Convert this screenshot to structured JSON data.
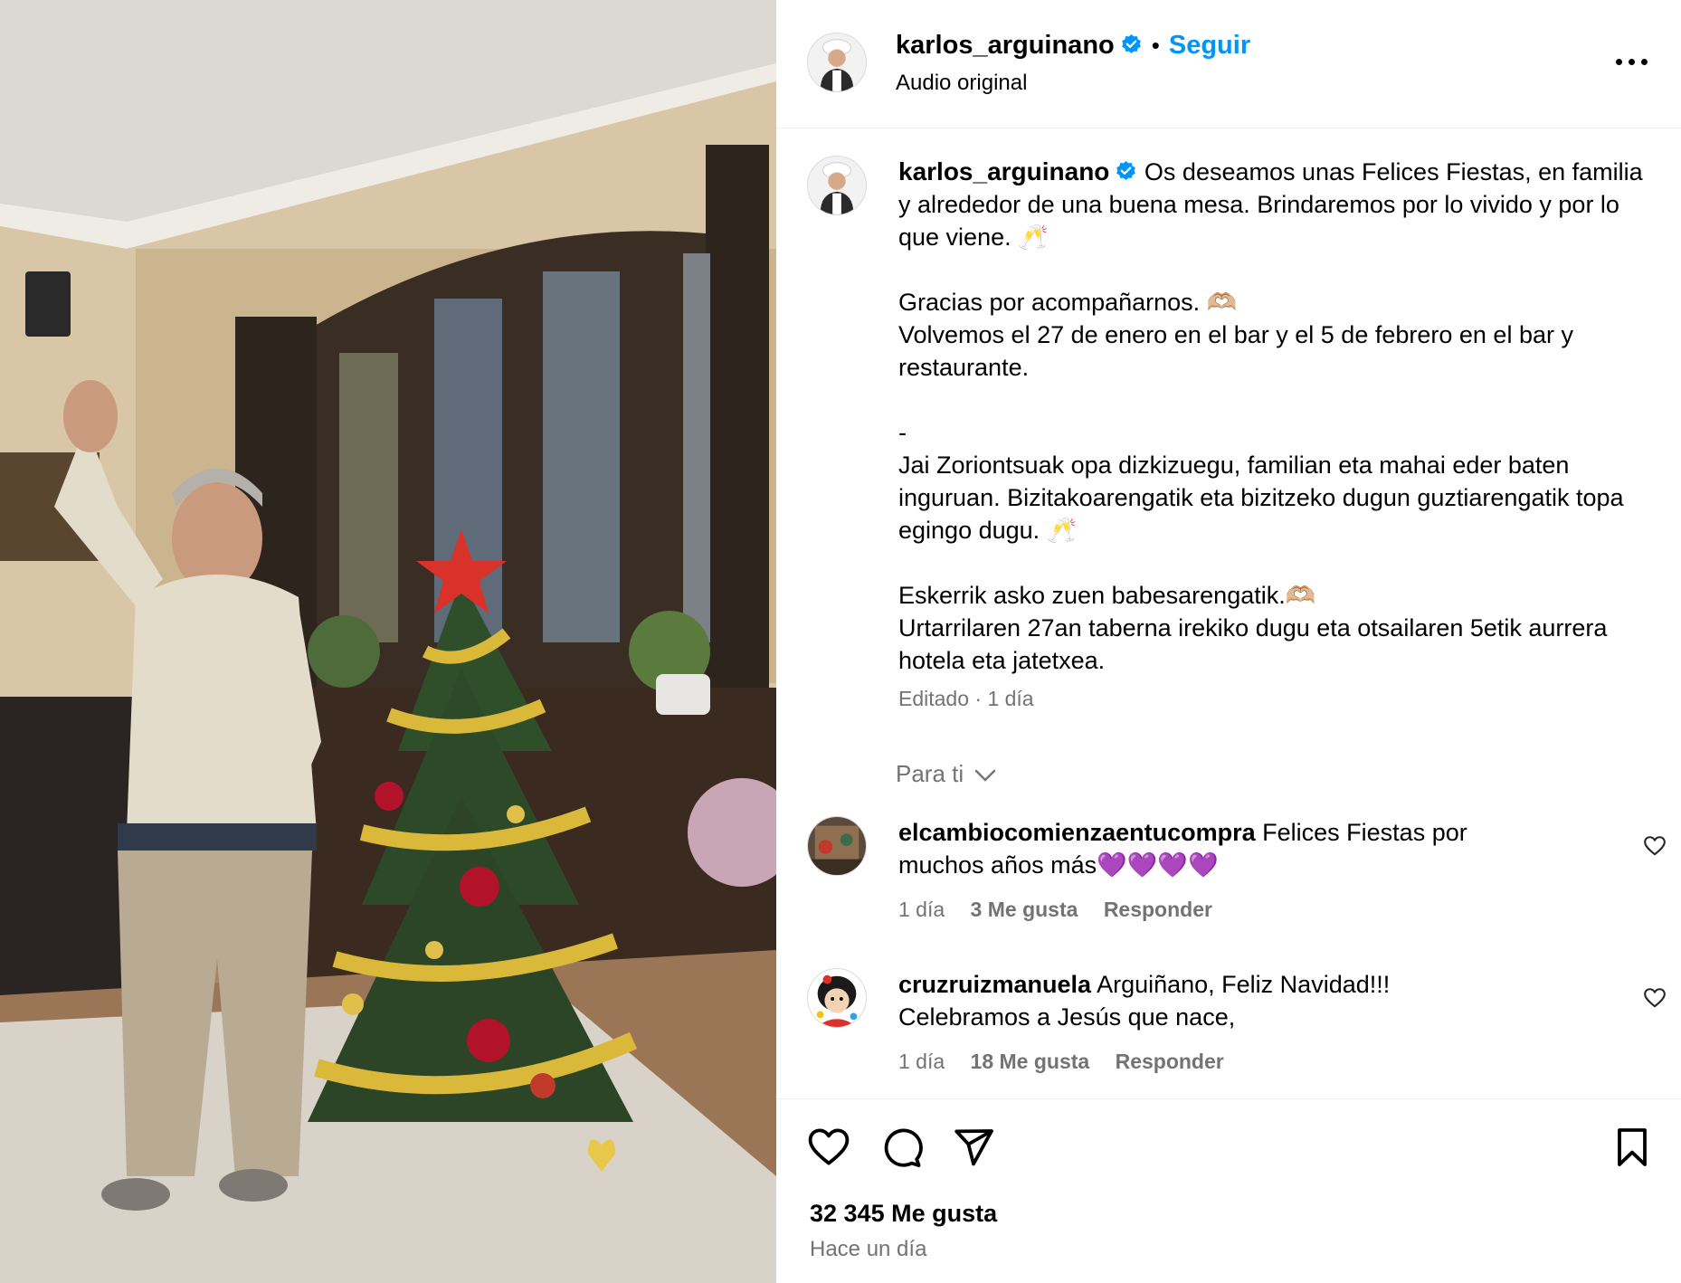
{
  "post": {
    "author": "karlos_arguinano",
    "follow_label": "Seguir",
    "separator": "•",
    "audio_label": "Audio original",
    "likes": "32 345 Me gusta",
    "posted_ago": "Hace un día"
  },
  "caption": {
    "author": "karlos_arguinano",
    "line1": "Os deseamos unas Felices Fiestas, en familia y alrededor de una buena mesa. Brindaremos por lo vivido y por lo que viene. 🥂",
    "line2": "Gracias por acompañarnos. 🫶🏼",
    "line3": "Volvemos el 27 de enero en el bar y el 5 de febrero en el bar y restaurante.",
    "line4": "-",
    "line5": "Jai Zoriontsuak opa dizkizuegu, familian eta mahai eder baten inguruan. Bizitakoarengatik eta bizitzeko dugun guztiarengatik topa egingo dugu. 🥂",
    "line6": "Eskerrik asko zuen babesarengatik.🫶🏼",
    "line7": "Urtarrilaren 27an taberna irekiko dugu eta otsailaren 5etik aurrera hotela eta jatetxea.",
    "meta": "Editado · 1 día"
  },
  "comments_filter": "Para ti",
  "comments": [
    {
      "author": "elcambiocomienzaentucompra",
      "text": "Felices Fiestas por muchos años más💜💜💜💜",
      "time": "1 día",
      "likes": "3 Me gusta",
      "reply": "Responder"
    },
    {
      "author": "cruzruizmanuela",
      "text": "Arguiñano, Feliz Navidad!!! Celebramos a Jesús que nace,",
      "time": "1 día",
      "likes": "18 Me gusta",
      "reply": "Responder"
    }
  ],
  "colors": {
    "accent": "#0095f6",
    "secondary_text": "#737373",
    "divider": "#efefef"
  },
  "icons": [
    "verified-badge-icon",
    "more-options-icon",
    "chevron-down-icon",
    "heart-icon",
    "comment-icon",
    "share-icon",
    "bookmark-icon"
  ]
}
